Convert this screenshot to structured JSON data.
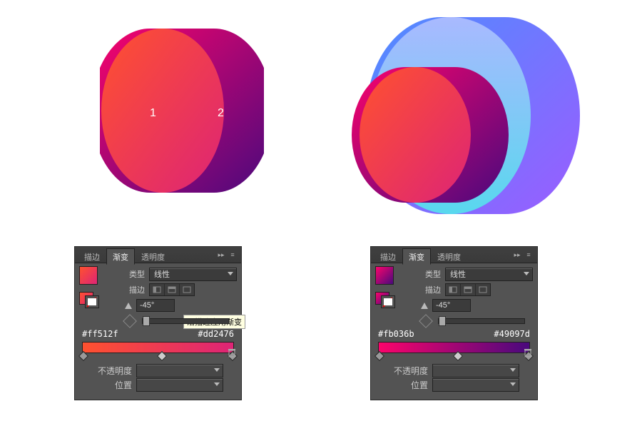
{
  "shapes": {
    "left": {
      "label1": "1",
      "label2": "2"
    }
  },
  "tabs": {
    "stroke": "描边",
    "gradient": "渐变",
    "opacity": "透明度"
  },
  "labels": {
    "type": "类型",
    "stroke": "描边",
    "linear": "线性",
    "opacityPct": "不透明度",
    "position": "位置"
  },
  "panels": [
    {
      "angle": "-45°",
      "hex_left": "#ff512f",
      "hex_right": "#dd2476",
      "swatch_css": "linear-gradient(135deg,#ff512f,#dd2476)",
      "fill_css": "linear-gradient(90deg,#ff512f,#dd2476)",
      "stop_left": "#ff512f",
      "stop_right": "#dd2476",
      "tooltip": "沿描边应用渐变"
    },
    {
      "angle": "-45°",
      "hex_left": "#fb036b",
      "hex_right": "#49097d",
      "swatch_css": "linear-gradient(135deg,#fb036b,#49097d)",
      "fill_css": "linear-gradient(90deg,#fb036b,#49097d)",
      "stop_left": "#fb036b",
      "stop_right": "#49097d"
    }
  ]
}
